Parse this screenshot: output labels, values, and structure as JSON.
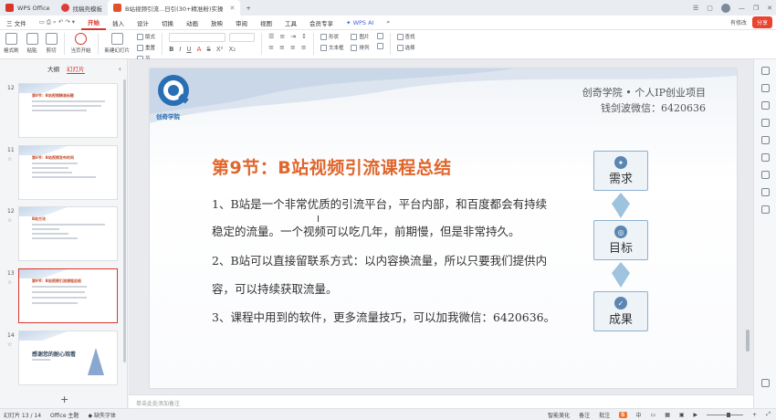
{
  "titlebar": {
    "tabs": [
      {
        "label": "WPS Office",
        "color": "#d9352b",
        "active": false
      },
      {
        "label": "找稿壳模板",
        "color": "#e03b3b",
        "active": false
      },
      {
        "label": "B站视频引流...日引(30+精准粉)实操",
        "color": "#e2522a",
        "active": true
      }
    ],
    "new_tab": "+",
    "right_icons": [
      "list-icon",
      "window-icon",
      "avatar",
      "minimize-icon",
      "maximize-icon",
      "close-icon"
    ]
  },
  "menubar": {
    "file": "三 文件",
    "items": [
      "开始",
      "插入",
      "设计",
      "切换",
      "动画",
      "放映",
      "审阅",
      "视图",
      "工具",
      "会员专享"
    ],
    "active": "开始",
    "ai": "WPS AI",
    "edit_status": "有修改",
    "share": "分享"
  },
  "ribbon": {
    "format_painter": "格式刷",
    "paste": "粘贴",
    "cut": "剪切",
    "play_from_current": "当页开始",
    "new_slide": "新建幻灯片",
    "layout": "版式",
    "reset": "重置",
    "section": "节",
    "shape": "形状",
    "picture": "图片",
    "textbox": "文本框",
    "arrange": "排列",
    "find_replace": "查找",
    "select": "选择",
    "format_marks": [
      "B",
      "I",
      "U",
      "A",
      "S",
      "X²",
      "X₂"
    ]
  },
  "leftpanel": {
    "tabs": [
      "大纲",
      "幻灯片"
    ],
    "active_tab": "幻灯片",
    "thumbs": [
      {
        "num": "12",
        "title": "第8节：B站视频精准标题",
        "lines": 3
      },
      {
        "num": "11",
        "title": "第6节：B站视频发布时间",
        "lines": 4
      },
      {
        "num": "12",
        "title": "B站方法",
        "lines": 4
      },
      {
        "num": "13",
        "title": "第9节：B站视频引流课程总结",
        "lines": 4,
        "selected": true
      },
      {
        "num": "14",
        "title": "感谢您的耐心观看",
        "lines": 1
      }
    ],
    "add": "+"
  },
  "slide": {
    "logo_text": "创奇学院",
    "header_line1": "创奇学院 • 个人IP创业项目",
    "header_line2": "钱剑波微信：6420636",
    "title": "第9节：B站视频引流课程总结",
    "body": [
      "1、B站是一个非常优质的引流平台，平台内部，和百度都会有持续",
      "稳定的流量。一个视频可以吃几年，前期慢，但是非常持久。",
      "2、B站可以直接留联系方式：以内容换流量，所以只要我们提供内",
      "容，可以持续获取流量。",
      "3、课程中用到的软件，更多流量技巧，可以加我微信：6420636。"
    ],
    "cursor": "I",
    "cards": [
      {
        "label": "需求",
        "icon": "bulb-icon"
      },
      {
        "label": "目标",
        "icon": "target-icon"
      },
      {
        "label": "成果",
        "icon": "clipboard-check-icon"
      }
    ],
    "notes_placeholder": "单击此处添加备注"
  },
  "statusbar": {
    "slide_pos": "幻灯片 13 / 14",
    "theme": "Office 主题",
    "font_missing": "缺失字体",
    "smart_beautify": "智能美化",
    "notes": "备注",
    "comments": "批注",
    "ime": "S",
    "ime_label": "中"
  },
  "colors": {
    "accent": "#d9352b",
    "title_orange": "#e0662c",
    "card_border": "#8fb0ce"
  }
}
